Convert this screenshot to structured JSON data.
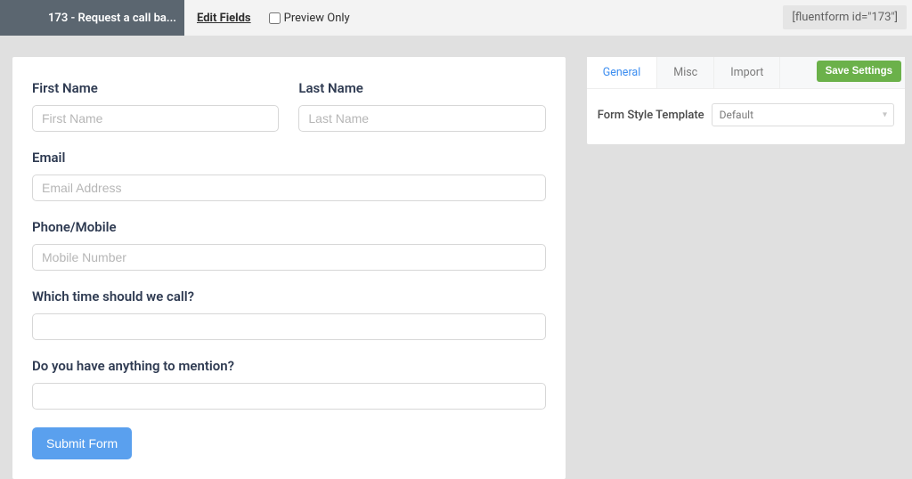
{
  "topbar": {
    "title": "173 - Request a call ba...",
    "edit_fields": "Edit Fields",
    "preview_only": "Preview Only",
    "shortcode": "[fluentform id=\"173\"]"
  },
  "form": {
    "first_name": {
      "label": "First Name",
      "placeholder": "First Name"
    },
    "last_name": {
      "label": "Last Name",
      "placeholder": "Last Name"
    },
    "email": {
      "label": "Email",
      "placeholder": "Email Address"
    },
    "phone": {
      "label": "Phone/Mobile",
      "placeholder": "Mobile Number"
    },
    "time": {
      "label": "Which time should we call?",
      "placeholder": ""
    },
    "mention": {
      "label": "Do you have anything to mention?",
      "placeholder": ""
    },
    "submit": "Submit Form"
  },
  "side": {
    "tabs": {
      "general": "General",
      "misc": "Misc",
      "import": "Import"
    },
    "save": "Save Settings",
    "style_label": "Form Style Template",
    "style_value": "Default"
  }
}
